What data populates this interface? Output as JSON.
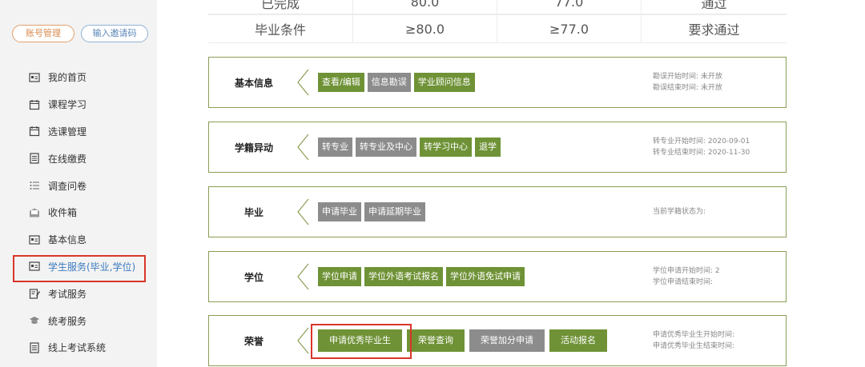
{
  "sidebar": {
    "account_btn": "账号管理",
    "invite_btn": "输入邀请码",
    "items": [
      {
        "label": "我的首页",
        "icon": "home-card-icon"
      },
      {
        "label": "课程学习",
        "icon": "calendar-icon"
      },
      {
        "label": "选课管理",
        "icon": "calendar-icon"
      },
      {
        "label": "在线缴费",
        "icon": "document-icon"
      },
      {
        "label": "调查问卷",
        "icon": "list-icon"
      },
      {
        "label": "收件箱",
        "icon": "inbox-icon"
      },
      {
        "label": "基本信息",
        "icon": "id-card-icon"
      },
      {
        "label": "学生服务(毕业,学位)",
        "icon": "id-card-icon",
        "active": true
      },
      {
        "label": "考试服务",
        "icon": "edit-icon"
      },
      {
        "label": "统考服务",
        "icon": "mortarboard-icon"
      },
      {
        "label": "线上考试系统",
        "icon": "document-icon"
      }
    ]
  },
  "score_table": {
    "rows": [
      [
        "已完成",
        "80.0",
        "77.0",
        "通过"
      ],
      [
        "毕业条件",
        "≥80.0",
        "≥77.0",
        "要求通过"
      ]
    ]
  },
  "sections": [
    {
      "title": "基本信息",
      "buttons": [
        {
          "label": "查看/编辑",
          "style": "green"
        },
        {
          "label": "信息勘误",
          "style": "gray"
        },
        {
          "label": "学业顾问信息",
          "style": "green"
        }
      ],
      "info": [
        "勘误开始时间: 未开放",
        "勘误结束时间: 未开放"
      ]
    },
    {
      "title": "学籍异动",
      "buttons": [
        {
          "label": "转专业",
          "style": "gray"
        },
        {
          "label": "转专业及中心",
          "style": "gray"
        },
        {
          "label": "转学习中心",
          "style": "green"
        },
        {
          "label": "退学",
          "style": "green"
        }
      ],
      "info": [
        "转专业开始时间: 2020-09-01",
        "转专业结束时间: 2020-11-30"
      ]
    },
    {
      "title": "毕业",
      "buttons": [
        {
          "label": "申请毕业",
          "style": "gray"
        },
        {
          "label": "申请延期毕业",
          "style": "gray"
        }
      ],
      "info": [
        "当前学籍状态为:"
      ]
    },
    {
      "title": "学位",
      "buttons": [
        {
          "label": "学位申请",
          "style": "green"
        },
        {
          "label": "学位外语考试报名",
          "style": "green"
        },
        {
          "label": "学位外语免试申请",
          "style": "green"
        }
      ],
      "info": [
        "学位申请开始时间: 2",
        "学位申请结束时间:"
      ]
    },
    {
      "title": "荣誉",
      "buttons": [
        {
          "label": "申请优秀毕业生",
          "style": "green"
        },
        {
          "label": "荣誉查询",
          "style": "green"
        },
        {
          "label": "荣誉加分申请",
          "style": "gray"
        },
        {
          "label": "活动报名",
          "style": "green"
        }
      ],
      "info": [
        "申请优秀毕业生开始时间:",
        "申请优秀毕业生结束时间:"
      ]
    }
  ],
  "colors": {
    "green": "#6f9236",
    "gray": "#8c8c8c",
    "highlight": "#d9362b",
    "active_link": "#3b7bbf"
  }
}
